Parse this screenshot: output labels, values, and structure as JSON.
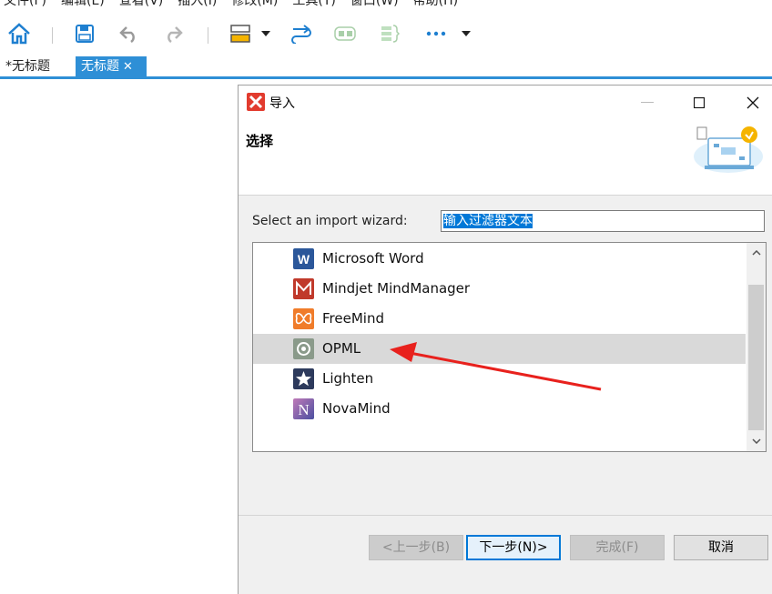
{
  "menu": [
    "文件(F)",
    "编辑(E)",
    "查看(V)",
    "插入(I)",
    "修改(M)",
    "工具(T)",
    "窗口(W)",
    "帮助(H)"
  ],
  "tabs": [
    {
      "label": "*无标题",
      "active": false
    },
    {
      "label": "无标题",
      "active": true
    }
  ],
  "dialog": {
    "title": "导入",
    "subtitle": "选择",
    "filter_label": "Select an import wizard:",
    "filter_value": "输入过滤器文本",
    "items": [
      {
        "label": "Microsoft Word",
        "icon": "word-icon",
        "color": "#2b579a"
      },
      {
        "label": "Mindjet MindManager",
        "icon": "mindmanager-icon",
        "color": "#c0392b"
      },
      {
        "label": "FreeMind",
        "icon": "freemind-icon",
        "color": "#f07c2a"
      },
      {
        "label": "OPML",
        "icon": "opml-icon",
        "color": "#8a9a8a",
        "selected": true
      },
      {
        "label": "Lighten",
        "icon": "lighten-icon",
        "color": "#2d3a5c"
      },
      {
        "label": "NovaMind",
        "icon": "novamind-icon",
        "color": "#6c5fa8"
      }
    ],
    "buttons": {
      "back": "<上一步(B)",
      "next": "下一步(N)>",
      "finish": "完成(F)",
      "cancel": "取消"
    }
  },
  "colors": {
    "accent": "#2e8fd6",
    "annotation_arrow": "#e8211d",
    "brand": "#e23b2e"
  }
}
